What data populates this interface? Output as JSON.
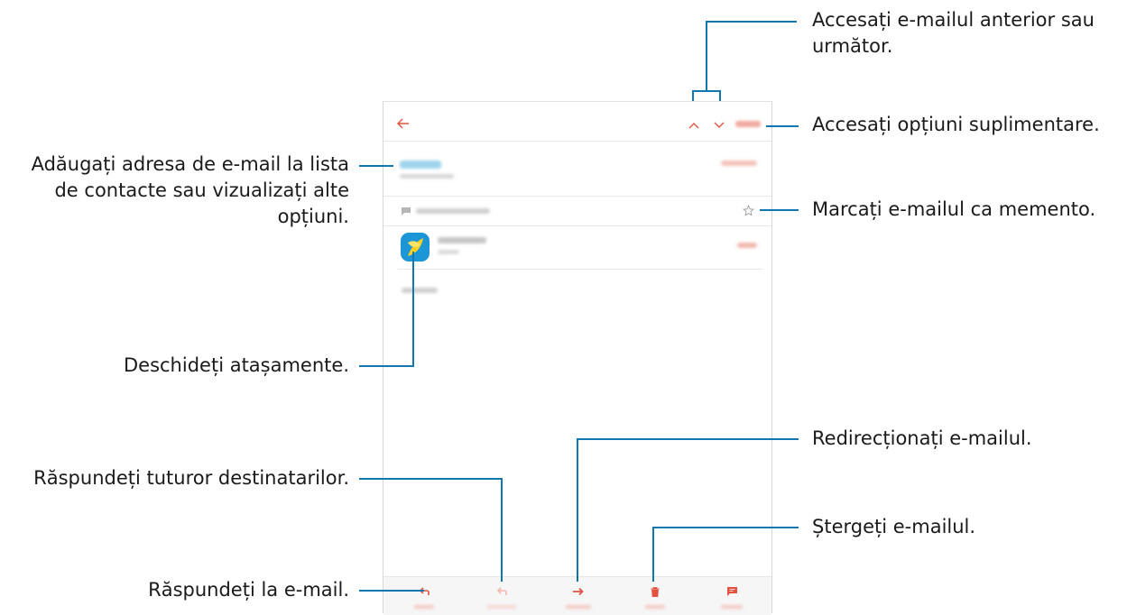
{
  "callouts": {
    "prev_next": "Accesați e-mailul anterior sau",
    "prev_next_2": "următor.",
    "more_options": "Accesați opțiuni suplimentare.",
    "add_contact_1": "Adăugați adresa de e-mail la lista",
    "add_contact_2": "de contacte sau vizualizați alte",
    "add_contact_3": "opțiuni.",
    "star": "Marcați e-mailul ca memento.",
    "attachments": "Deschideți atașamente.",
    "reply_all": "Răspundeți tuturor destinatarilor.",
    "forward": "Redirecționați e-mailul.",
    "delete": "Ștergeți e-mailul.",
    "reply": "Răspundeți la e-mail."
  },
  "colors": {
    "accent": "#e2523f",
    "leader": "#1177b0",
    "sender_blur": "#7cc5e6",
    "gray_blur": "#c9c9c9"
  },
  "icons": [
    "back-arrow-icon",
    "chevron-up-icon",
    "chevron-down-icon",
    "star-icon",
    "reply-icon",
    "reply-all-icon",
    "forward-icon",
    "trash-icon",
    "compose-icon",
    "chat-icon",
    "gallery-icon"
  ]
}
